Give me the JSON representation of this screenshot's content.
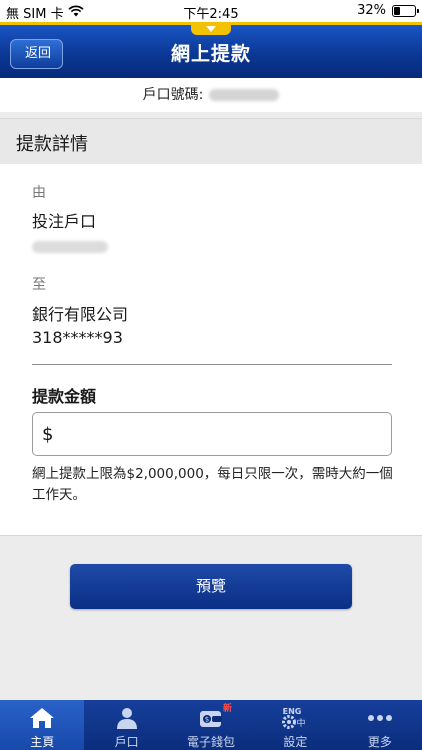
{
  "status_bar": {
    "carrier": "無 SIM 卡",
    "time": "下午2:45",
    "battery": "32%",
    "battery_level": 0.32
  },
  "header": {
    "back_label": "返回",
    "title": "網上提款"
  },
  "account": {
    "label": "戶口號碼:"
  },
  "section": {
    "title": "提款詳情"
  },
  "details": {
    "from_label": "由",
    "from_value": "投注戶口",
    "to_label": "至",
    "to_value": "銀行有限公司",
    "to_account": "318*****93"
  },
  "amount": {
    "label": "提款金額",
    "currency": "$",
    "value": "",
    "placeholder": ""
  },
  "note": "網上提款上限為$2,000,000，每日只限一次，需時大約一個工作天。",
  "preview_button": "預覽",
  "tabs": [
    {
      "label": "主頁",
      "icon": "home-icon",
      "active": true
    },
    {
      "label": "戶口",
      "icon": "person-icon",
      "active": false
    },
    {
      "label": "電子錢包",
      "icon": "wallet-icon",
      "active": false,
      "badge": "新"
    },
    {
      "label": "設定",
      "icon": "gear-icon",
      "active": false,
      "icon_text_top": "ENG",
      "icon_text_side": "中"
    },
    {
      "label": "更多",
      "icon": "more-icon",
      "active": false
    }
  ],
  "colors": {
    "header_blue": "#0b3895",
    "accent_yellow": "#f2c200",
    "button_blue": "#0a2f86"
  }
}
